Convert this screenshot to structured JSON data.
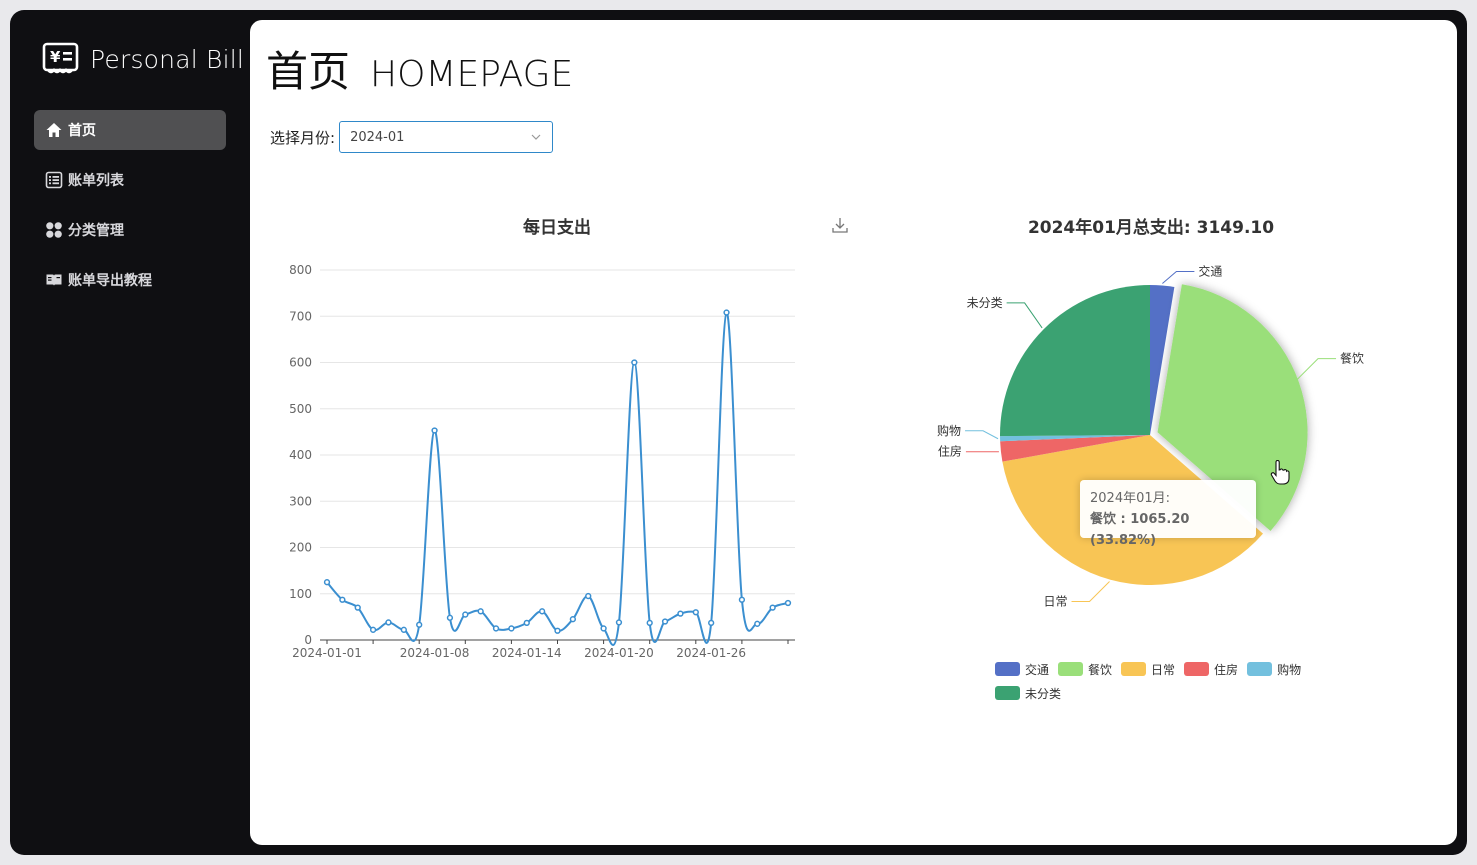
{
  "app": {
    "title": "Personal Bill"
  },
  "sidebar": {
    "items": [
      {
        "label": "首页",
        "icon": "home-icon",
        "active": true
      },
      {
        "label": "账单列表",
        "icon": "list-icon",
        "active": false
      },
      {
        "label": "分类管理",
        "icon": "grid-icon",
        "active": false
      },
      {
        "label": "账单导出教程",
        "icon": "book-icon",
        "active": false
      }
    ]
  },
  "page": {
    "title_cn": "首页",
    "title_en": "HOMEPAGE"
  },
  "month_filter": {
    "label": "选择月份:",
    "value": "2024-01"
  },
  "colors": {
    "line": "#3b8fd0",
    "select_border": "#2f88c9",
    "sidebar_bg": "#0f0f12",
    "active_nav": "#505052"
  },
  "chart_data": [
    {
      "type": "line",
      "title": "每日支出",
      "x": [
        "2024-01-01",
        "2024-01-02",
        "2024-01-03",
        "2024-01-04",
        "2024-01-05",
        "2024-01-06",
        "2024-01-07",
        "2024-01-08",
        "2024-01-09",
        "2024-01-10",
        "2024-01-11",
        "2024-01-12",
        "2024-01-13",
        "2024-01-14",
        "2024-01-15",
        "2024-01-16",
        "2024-01-17",
        "2024-01-18",
        "2024-01-19",
        "2024-01-20",
        "2024-01-21",
        "2024-01-22",
        "2024-01-23",
        "2024-01-24",
        "2024-01-25",
        "2024-01-26",
        "2024-01-27",
        "2024-01-28",
        "2024-01-29",
        "2024-01-30",
        "2024-01-31"
      ],
      "series": [
        {
          "values": [
            125,
            87,
            70,
            22,
            38,
            22,
            33,
            453,
            48,
            55,
            62,
            25,
            25,
            37,
            62,
            20,
            45,
            95,
            25,
            38,
            600,
            37,
            40,
            57,
            60,
            37,
            708,
            87,
            35,
            70,
            80
          ]
        }
      ],
      "xticks": [
        "2024-01-01",
        "2024-01-08",
        "2024-01-14",
        "2024-01-20",
        "2024-01-26"
      ],
      "yticks": [
        0,
        100,
        200,
        300,
        400,
        500,
        600,
        700,
        800
      ],
      "ylim": [
        0,
        800
      ],
      "grid": true
    },
    {
      "type": "pie",
      "title": "2024年01月总支出: 3149.10",
      "slices": [
        {
          "name": "交通",
          "value": 81.8,
          "color": "#5470c6"
        },
        {
          "name": "餐饮",
          "value": 1065.2,
          "color": "#9adf7a"
        },
        {
          "name": "日常",
          "value": 1125.3,
          "color": "#f8c555"
        },
        {
          "name": "住房",
          "value": 68.5,
          "color": "#ee6666"
        },
        {
          "name": "购物",
          "value": 17.3,
          "color": "#73c0de"
        },
        {
          "name": "未分类",
          "value": 791.0,
          "color": "#3ba272"
        }
      ],
      "legend_position": "bottom"
    }
  ],
  "tooltip": {
    "title": "2024年01月:",
    "value_text": "餐饮 : 1065.20 (33.82%)"
  }
}
